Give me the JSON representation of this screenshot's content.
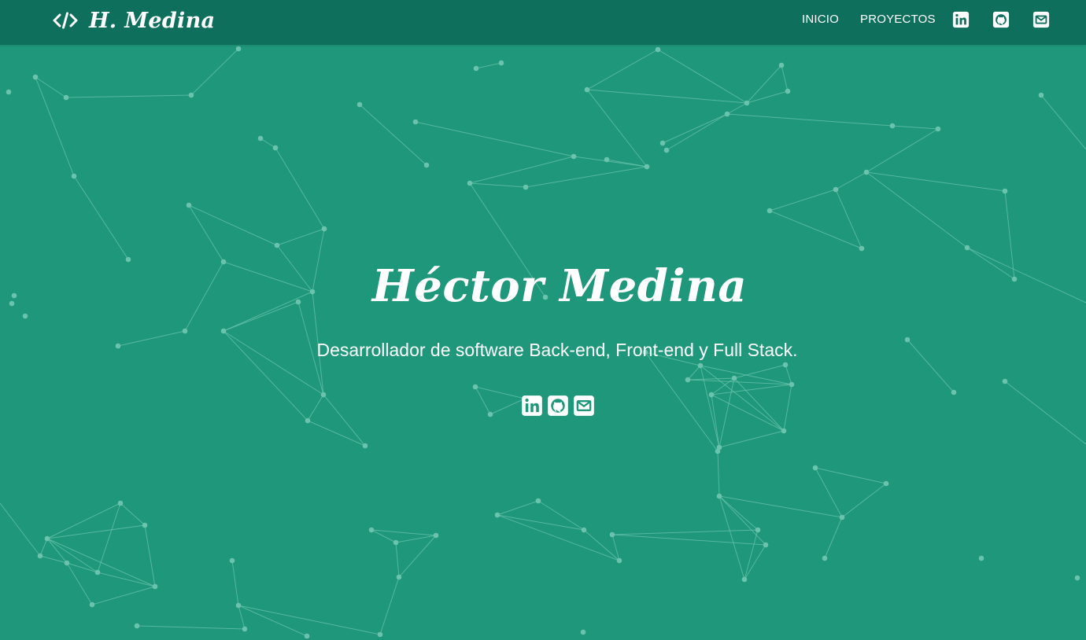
{
  "brand": {
    "name": "H. Medina",
    "icon": "code-slash-icon"
  },
  "nav": {
    "links": [
      {
        "label": "INICIO"
      },
      {
        "label": "PROYECTOS"
      }
    ],
    "icons": [
      "linkedin-icon",
      "github-icon",
      "envelope-icon"
    ]
  },
  "hero": {
    "title": "Héctor Medina",
    "subtitle": "Desarrollador de software Back-end, Front-end y Full Stack.",
    "icons": [
      "linkedin-icon",
      "github-icon",
      "envelope-icon"
    ]
  },
  "colors": {
    "background": "#1e977a",
    "navbar": "#0e6f5d",
    "particles": "#6cc3ad",
    "text": "#ffffff"
  }
}
